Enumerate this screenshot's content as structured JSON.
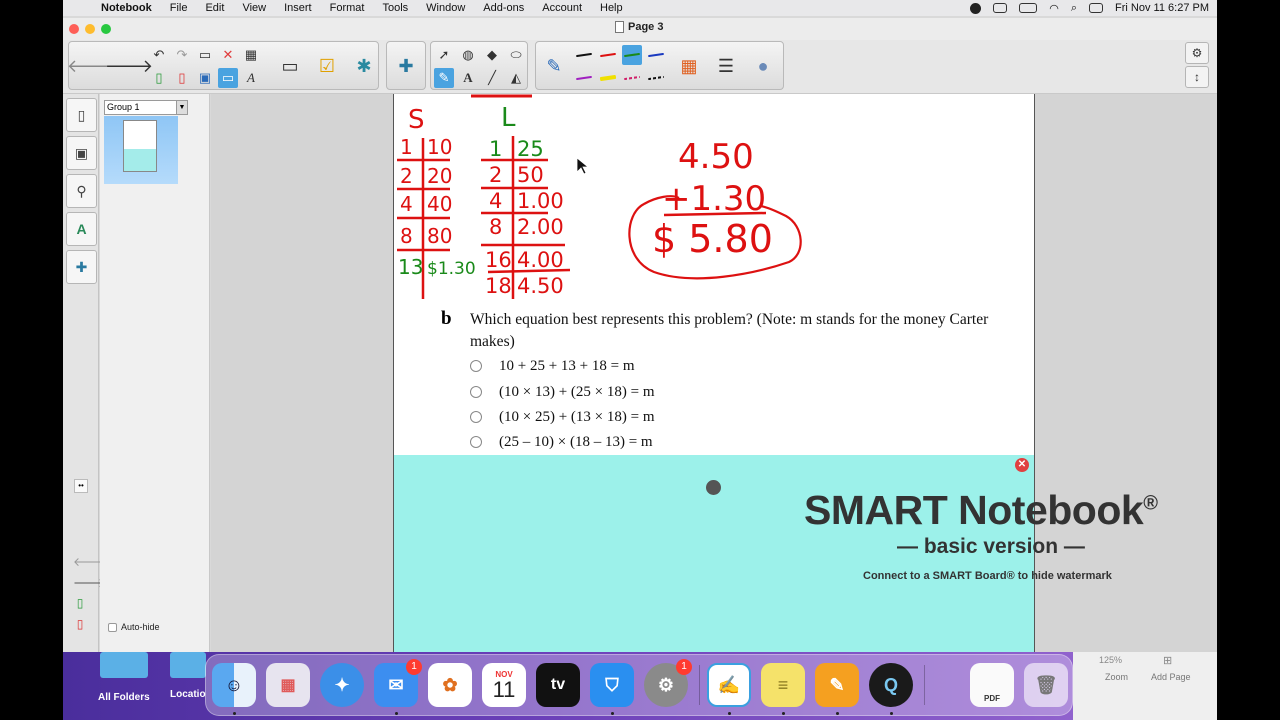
{
  "menubar": {
    "app_name": "Notebook",
    "items": [
      "File",
      "Edit",
      "View",
      "Insert",
      "Format",
      "Tools",
      "Window",
      "Add-ons",
      "Account",
      "Help"
    ],
    "clock": "Fri Nov 11  6:27 PM"
  },
  "window": {
    "title": "Page 3"
  },
  "sorter": {
    "group_label": "Group 1",
    "auto_hide_label": "Auto-hide"
  },
  "page": {
    "handwriting": {
      "col_s_header": "S",
      "col_l_header": "L",
      "s_rows": [
        [
          "1",
          "10"
        ],
        [
          "2",
          "20"
        ],
        [
          "4",
          "40"
        ],
        [
          "8",
          "80"
        ],
        [
          "13",
          "$1.30"
        ]
      ],
      "l_rows": [
        [
          "1",
          "25"
        ],
        [
          "2",
          "50"
        ],
        [
          "4",
          "1.00"
        ],
        [
          "8",
          "2.00"
        ],
        [
          "16",
          "4.00"
        ],
        [
          "18",
          "4.50"
        ]
      ],
      "sum_line1": "4.50",
      "sum_line2": "+1.30",
      "sum_result": "$ 5.80"
    },
    "question_letter": "b",
    "question_text": "Which equation best represents this problem? (Note: m stands for the money Carter makes)",
    "options": [
      "10 + 25 + 13 + 18 = m",
      "(10 × 13) + (25 × 18) = m",
      "(10 × 25) + (13 × 18) = m",
      "(25 – 10) × (18 – 13) = m"
    ]
  },
  "watermark": {
    "title": "SMART Notebook",
    "registered": "®",
    "subtitle": "— basic version —",
    "connect_text": "Connect to a SMART Board® to hide watermark"
  },
  "desktop": {
    "folder1": "All Folders",
    "folder2": "Locatio",
    "zoom_value": "125%",
    "zoom_label": "Zoom",
    "add_page_label": "Add Page"
  },
  "dock": {
    "calendar_month": "NOV",
    "calendar_day": "11",
    "mail_badge": "1",
    "settings_badge": "1",
    "tv_label": "tv",
    "pdf_label": "PDF"
  }
}
